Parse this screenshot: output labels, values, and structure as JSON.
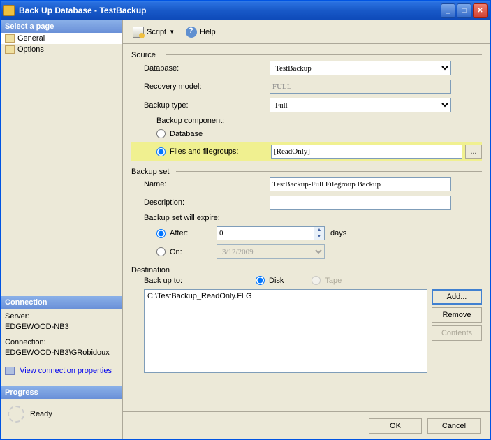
{
  "window": {
    "title": "Back Up Database - TestBackup"
  },
  "sidebar": {
    "select_page": "Select a page",
    "items": [
      {
        "label": "General"
      },
      {
        "label": "Options"
      }
    ],
    "connection_header": "Connection",
    "server_label": "Server:",
    "server_value": "EDGEWOOD-NB3",
    "connection_label": "Connection:",
    "connection_value": "EDGEWOOD-NB3\\GRobidoux",
    "view_props": "View connection properties",
    "progress_header": "Progress",
    "progress_status": "Ready"
  },
  "toolbar": {
    "script": "Script",
    "help": "Help"
  },
  "source": {
    "legend": "Source",
    "database_label": "Database:",
    "database_value": "TestBackup",
    "recovery_label": "Recovery model:",
    "recovery_value": "FULL",
    "backup_type_label": "Backup type:",
    "backup_type_value": "Full",
    "component_label": "Backup component:",
    "radio_database": "Database",
    "radio_files": "Files and filegroups:",
    "files_value": "[ReadOnly]",
    "browse": "..."
  },
  "backup_set": {
    "legend": "Backup set",
    "name_label": "Name:",
    "name_value": "TestBackup-Full Filegroup Backup",
    "desc_label": "Description:",
    "desc_value": "",
    "expire_label": "Backup set will expire:",
    "after_label": "After:",
    "after_value": "0",
    "after_unit": "days",
    "on_label": "On:",
    "on_value": "3/12/2009"
  },
  "destination": {
    "legend": "Destination",
    "back_up_to": "Back up to:",
    "disk": "Disk",
    "tape": "Tape",
    "list": [
      "C:\\TestBackup_ReadOnly.FLG"
    ],
    "add": "Add...",
    "remove": "Remove",
    "contents": "Contents"
  },
  "footer": {
    "ok": "OK",
    "cancel": "Cancel"
  }
}
